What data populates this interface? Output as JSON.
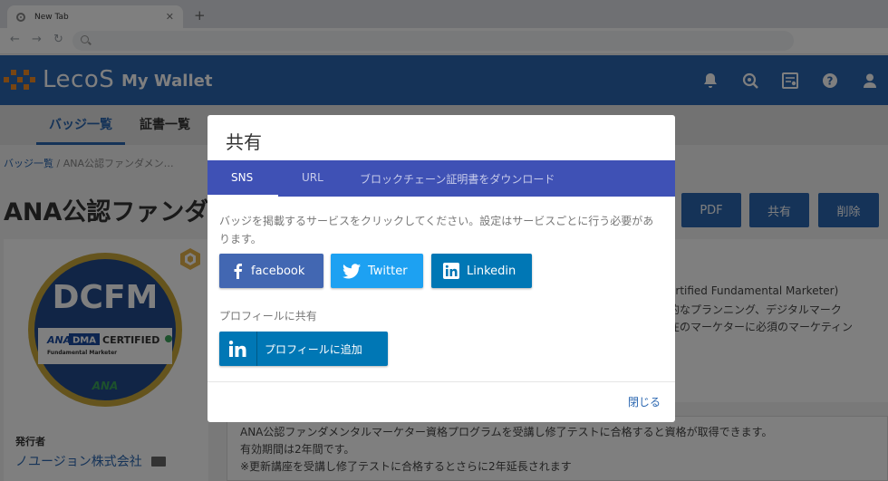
{
  "browser": {
    "tab_title": "New Tab",
    "tab_close": "✕",
    "new_tab": "+"
  },
  "header": {
    "logo_text": "LecoS",
    "app_name": "My Wallet"
  },
  "subnav": {
    "tabs": [
      {
        "label": "バッジ一覧"
      },
      {
        "label": "証書一覧"
      }
    ]
  },
  "page": {
    "breadcrumb_link": "バッジ一覧",
    "breadcrumb_current": " / ANA公認ファンダメン…",
    "title": "ANA公認ファンダ",
    "actions": {
      "pdf": "PDF",
      "share": "共有",
      "delete": "削除"
    },
    "badge": {
      "acronym": "DCFM",
      "ana": "ANA",
      "dma": "DMA",
      "certified": "CERTIFIED",
      "sub": "Fundamental Marketer",
      "bottom": "ANA"
    },
    "issuer_label": "発行者",
    "issuer_name": "ノユージョン株式会社",
    "description_lines": [
      "ertified Fundamental Marketer)",
      "的なプランニング、デジタルマーク",
      "在のマーケターに必須のマーケティン"
    ],
    "info_lines": [
      "ANA公認ファンダメンタルマーケター資格プログラムを受講し修了テストに合格すると資格が取得できます。",
      "有効期間は2年間です。",
      "※更新講座を受講し修了テストに合格するとさらに2年延長されます"
    ]
  },
  "modal": {
    "title": "共有",
    "tabs": [
      {
        "label": "SNS"
      },
      {
        "label": "URL"
      },
      {
        "label": "ブロックチェーン証明書をダウンロード"
      }
    ],
    "message": "バッジを掲載するサービスをクリックしてください。設定はサービスごとに行う必要があります。",
    "buttons": {
      "facebook": "facebook",
      "twitter": "Twitter",
      "linkedin": "Linkedin"
    },
    "profile_label": "プロフィールに共有",
    "profile_button": "プロフィールに追加",
    "close": "閉じる"
  },
  "colors": {
    "header_blue": "#2b67b1",
    "modal_tab_bar": "#3f51b5",
    "facebook": "#4267b2",
    "twitter": "#1da1f2",
    "linkedin": "#0077b5"
  }
}
